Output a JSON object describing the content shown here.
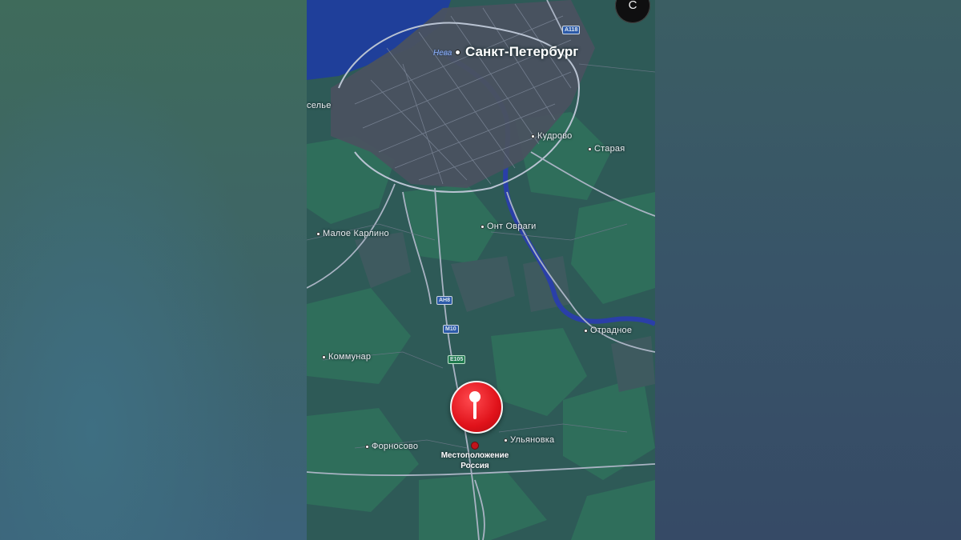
{
  "map": {
    "city": "Санкт-Петербург",
    "water": "Нева",
    "places": {
      "selye": "селье",
      "kudrovo": "Кудрово",
      "staraya": "Старая",
      "maloe_karlino": "Малое Карлино",
      "ont_ovragi": "Онт Овраги",
      "otradnoe": "Отрадное",
      "kommunar": "Коммунар",
      "fornosovo": "Форносово",
      "ulyanovka": "Ульяновка"
    },
    "road_shields": {
      "a118": "A118",
      "ah8": "AH8",
      "m10": "M10",
      "e105": "E105"
    },
    "marker": {
      "title": "Местоположение",
      "subtitle": "Россия",
      "color": "#e0121a"
    },
    "compass_label": "С",
    "colors": {
      "water": "#1f3f9a",
      "land": "#2e5a57",
      "urban": "#4a5260",
      "forest": "#2f6f5a",
      "road": "#9aa6b8"
    }
  }
}
